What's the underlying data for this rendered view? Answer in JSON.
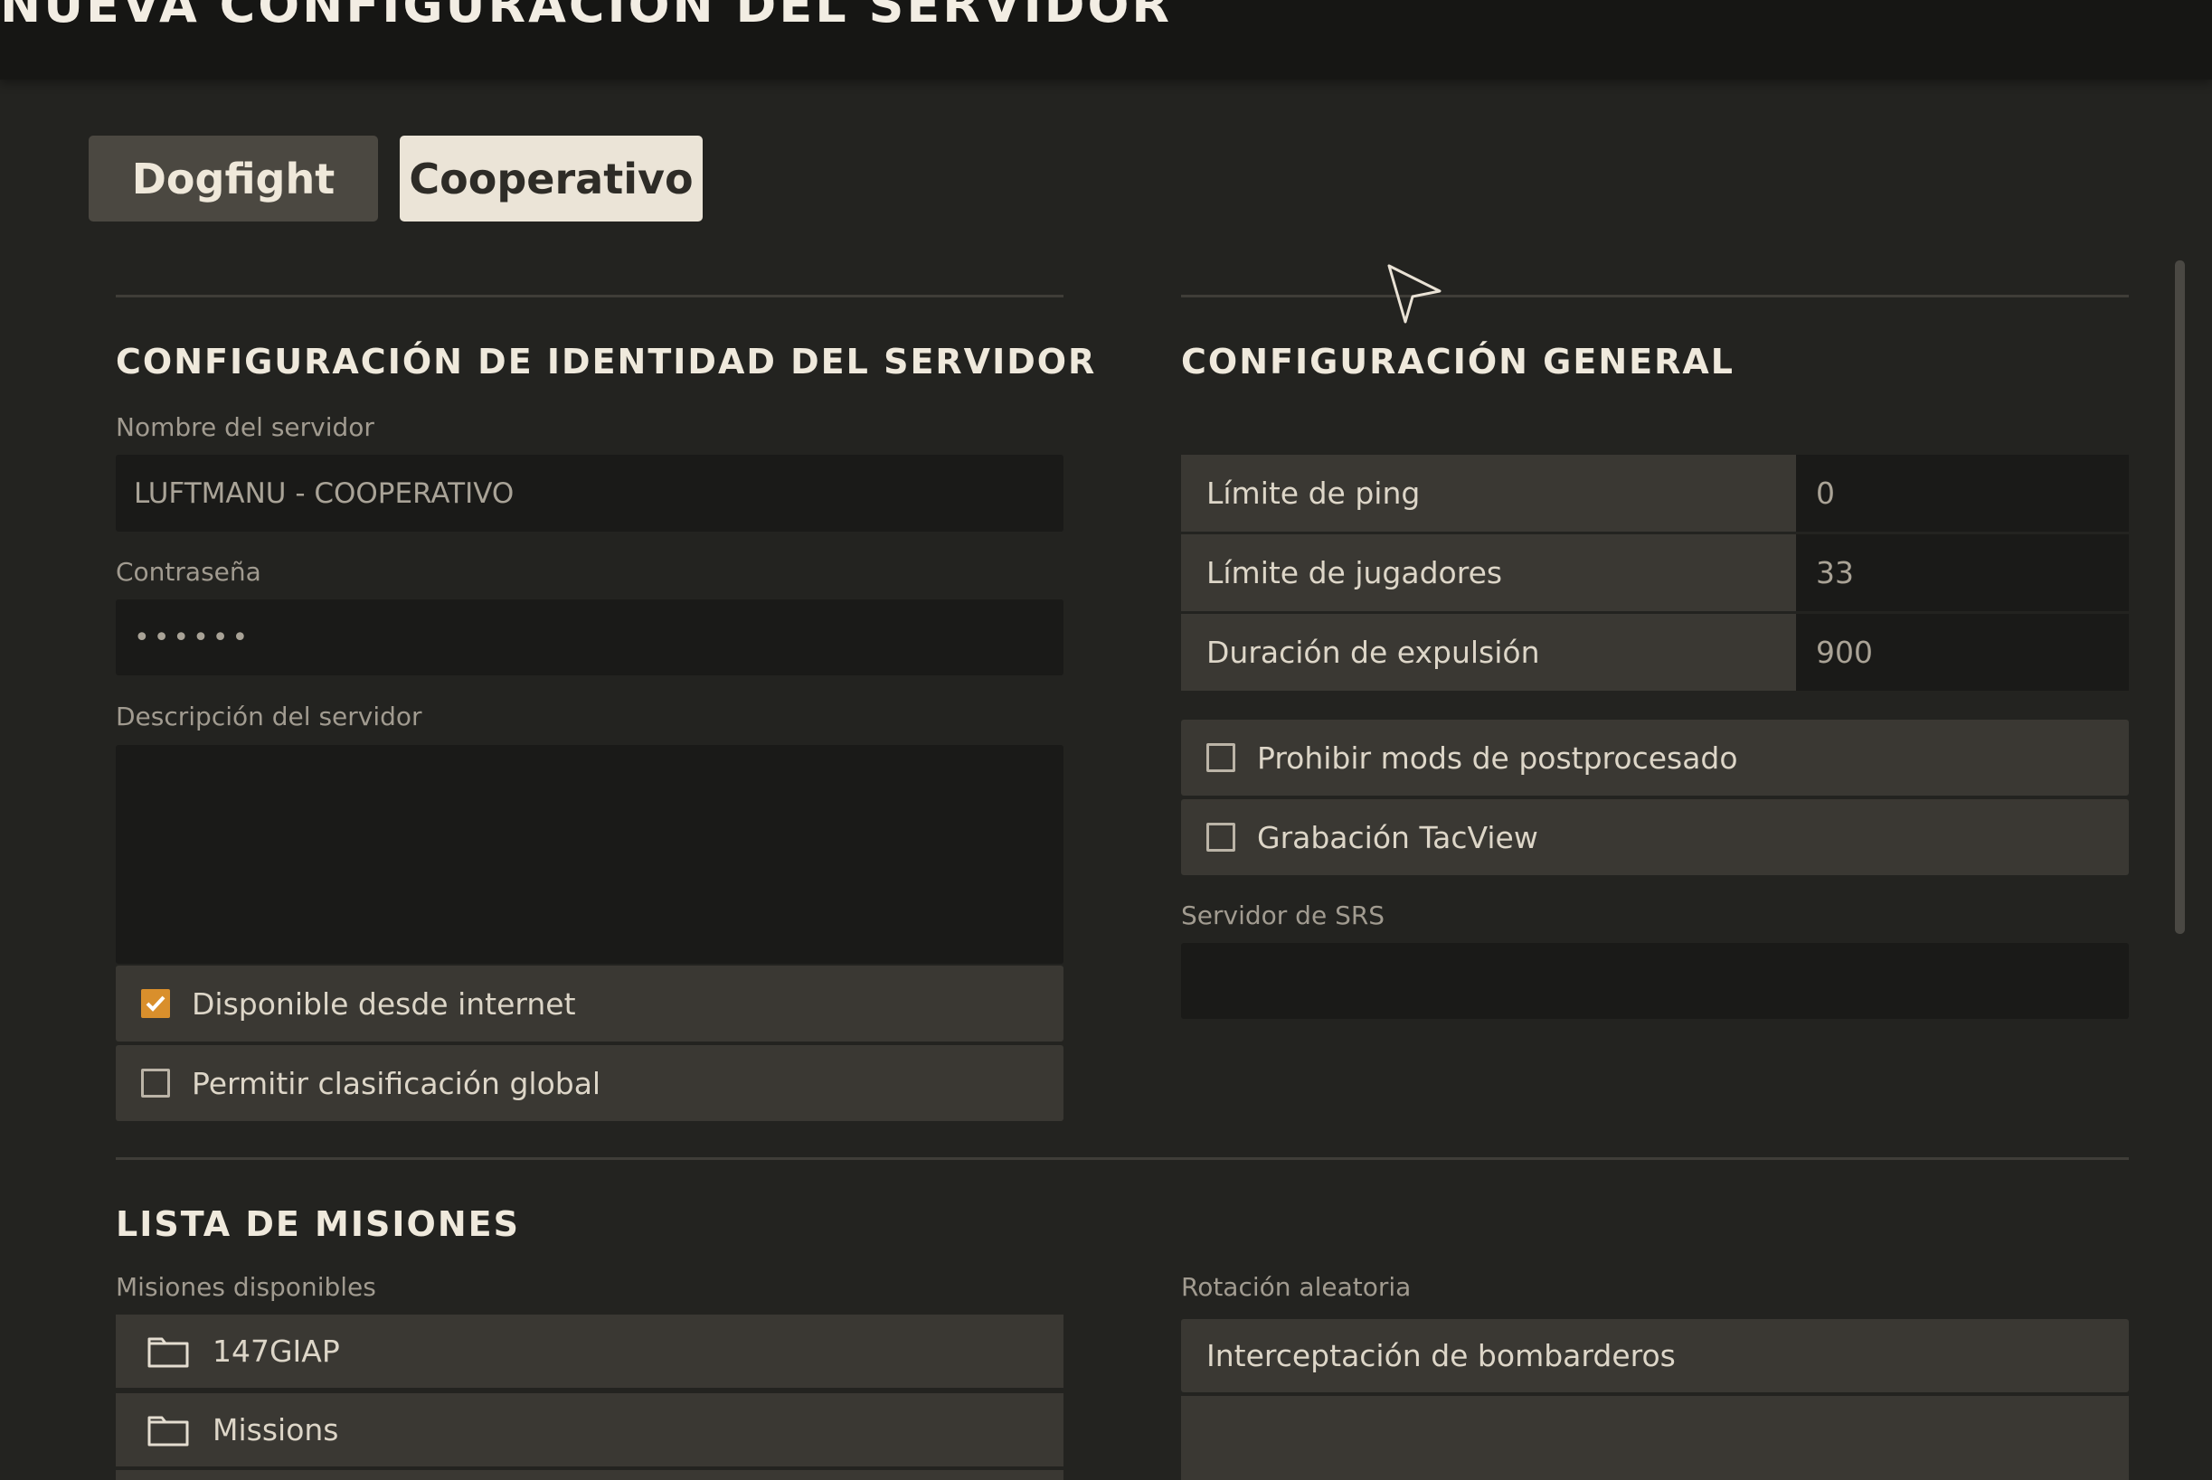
{
  "window": {
    "title": "NUEVA CONFIGURACIÓN DEL SERVIDOR"
  },
  "tabs": [
    {
      "label": "Dogfight",
      "active": false
    },
    {
      "label": "Cooperativo",
      "active": true
    }
  ],
  "identity": {
    "heading": "CONFIGURACIÓN DE IDENTIDAD DEL SERVIDOR",
    "name_label": "Nombre del servidor",
    "name_value": "LUFTMANU - COOPERATIVO",
    "password_label": "Contraseña",
    "password_value": "••••••",
    "description_label": "Descripción del servidor",
    "description_value": "",
    "checkboxes": [
      {
        "label": "Disponible desde internet",
        "checked": true
      },
      {
        "label": "Permitir clasificación global",
        "checked": false
      }
    ]
  },
  "general": {
    "heading": "CONFIGURACIÓN GENERAL",
    "fields": [
      {
        "label": "Límite de ping",
        "value": "0"
      },
      {
        "label": "Límite de jugadores",
        "value": "33"
      },
      {
        "label": "Duración de expulsión",
        "value": "900"
      }
    ],
    "checkboxes": [
      {
        "label": "Prohibir mods de postprocesado",
        "checked": false
      },
      {
        "label": "Grabación TacView",
        "checked": false
      }
    ],
    "srs_label": "Servidor de SRS",
    "srs_value": ""
  },
  "missions": {
    "heading": "LISTA DE MISIONES",
    "available_label": "Misiones disponibles",
    "available": [
      {
        "label": "147GIAP",
        "icon": "folder-icon"
      },
      {
        "label": "Missions",
        "icon": "folder-icon"
      }
    ],
    "rotation_label": "Rotación aleatoria",
    "rotation": [
      {
        "label": "Interceptación de bombarderos"
      }
    ]
  },
  "colors": {
    "accent": "#d98f2c",
    "background": "#232320",
    "panel_row": "#3a3833",
    "input": "#1a1a18",
    "tab_active": "#ebe4d7",
    "tab_inactive": "#4b4841"
  }
}
